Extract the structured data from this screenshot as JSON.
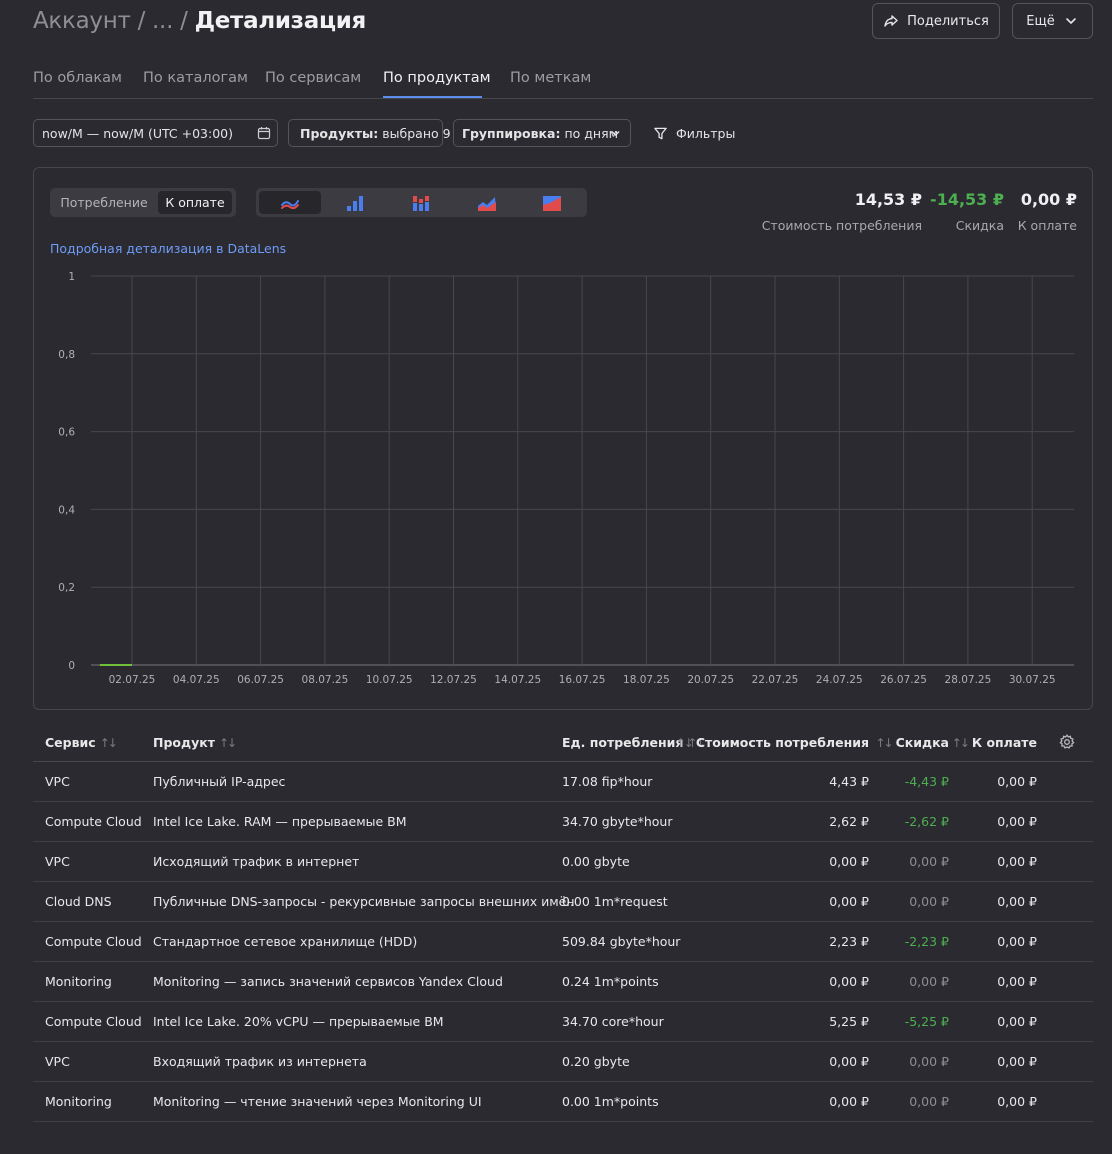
{
  "breadcrumb": {
    "root": "Аккаунт",
    "sep1": "/",
    "ellipsis": "...",
    "sep2": "/",
    "current": "Детализация"
  },
  "header": {
    "share_label": "Поделиться",
    "more_label": "Ещё"
  },
  "tabs": [
    {
      "label": "По облакам",
      "active": false
    },
    {
      "label": "По каталогам",
      "active": false
    },
    {
      "label": "По сервисам",
      "active": false
    },
    {
      "label": "По продуктам",
      "active": true
    },
    {
      "label": "По меткам",
      "active": false
    }
  ],
  "filters": {
    "date_range": "now/M — now/M (UTC +03:00)",
    "products_label": "Продукты:",
    "products_value": "выбрано 9",
    "grouping_label": "Группировка:",
    "grouping_value": "по дням",
    "filters_label": "Фильтры"
  },
  "chart_panel": {
    "mode_options": [
      "Потребление",
      "К оплате"
    ],
    "mode_selected": "К оплате",
    "chart_type_icons": [
      "line-chart-icon",
      "bar-chart-icon",
      "stacked-bar-chart-icon",
      "area-chart-icon",
      "stacked-area-chart-icon"
    ],
    "chart_type_selected": "line-chart-icon",
    "summary": [
      {
        "value": "14,53 ₽",
        "label": "Стоимость потребления",
        "color": "#f0f0f2"
      },
      {
        "value": "-14,53 ₽",
        "label": "Скидка",
        "color": "#4caf50"
      },
      {
        "value": "0,00 ₽",
        "label": "К оплате",
        "color": "#f0f0f2"
      }
    ],
    "datalens_link": "Подробная детализация в DataLens"
  },
  "chart_data": {
    "type": "line",
    "title": "",
    "xlabel": "",
    "ylabel": "",
    "ylim": [
      0,
      1
    ],
    "y_ticks": [
      "0",
      "0,2",
      "0,4",
      "0,6",
      "0,8",
      "1"
    ],
    "y_tick_values": [
      0,
      0.2,
      0.4,
      0.6,
      0.8,
      1
    ],
    "x_ticks": [
      "02.07.25",
      "04.07.25",
      "06.07.25",
      "08.07.25",
      "10.07.25",
      "12.07.25",
      "14.07.25",
      "16.07.25",
      "18.07.25",
      "20.07.25",
      "22.07.25",
      "24.07.25",
      "26.07.25",
      "28.07.25",
      "30.07.25"
    ],
    "x": [
      "01.07.25",
      "02.07.25"
    ],
    "series": [
      {
        "values": [
          0,
          0
        ],
        "color": "#6fbf3a"
      }
    ],
    "grid": true
  },
  "table": {
    "columns": [
      {
        "label": "Сервис",
        "sort": true
      },
      {
        "label": "Продукт",
        "sort": true
      },
      {
        "label": "Ед. потребления",
        "sort": true
      },
      {
        "label": "Стоимость потребления",
        "sort": true
      },
      {
        "label": "Скидка",
        "sort": true
      },
      {
        "label": "К оплате",
        "sort": true
      }
    ],
    "sort_glyph": "↑↓",
    "rows": [
      {
        "service": "VPC",
        "product": "Публичный IP-адрес",
        "unit": "17.08 fip*hour",
        "cost": "4,43 ₽",
        "discount": "-4,43 ₽",
        "discount_color": "green",
        "pay": "0,00 ₽"
      },
      {
        "service": "Compute Cloud",
        "product": "Intel Ice Lake. RAM — прерываемые ВМ",
        "unit": "34.70 gbyte*hour",
        "cost": "2,62 ₽",
        "discount": "-2,62 ₽",
        "discount_color": "green",
        "pay": "0,00 ₽"
      },
      {
        "service": "VPC",
        "product": "Исходящий трафик в интернет",
        "unit": "0.00 gbyte",
        "cost": "0,00 ₽",
        "discount": "0,00 ₽",
        "discount_color": "dim",
        "pay": "0,00 ₽"
      },
      {
        "service": "Cloud DNS",
        "product": "Публичные DNS-запросы - рекурсивные запросы внешних имён",
        "unit": "0.00 1m*request",
        "cost": "0,00 ₽",
        "discount": "0,00 ₽",
        "discount_color": "dim",
        "pay": "0,00 ₽"
      },
      {
        "service": "Compute Cloud",
        "product": "Стандартное сетевое хранилище (HDD)",
        "unit": "509.84 gbyte*hour",
        "cost": "2,23 ₽",
        "discount": "-2,23 ₽",
        "discount_color": "green",
        "pay": "0,00 ₽"
      },
      {
        "service": "Monitoring",
        "product": "Monitoring — запись значений сервисов Yandex Cloud",
        "unit": "0.24 1m*points",
        "cost": "0,00 ₽",
        "discount": "0,00 ₽",
        "discount_color": "dim",
        "pay": "0,00 ₽"
      },
      {
        "service": "Compute Cloud",
        "product": "Intel Ice Lake. 20% vCPU — прерываемые ВМ",
        "unit": "34.70 core*hour",
        "cost": "5,25 ₽",
        "discount": "-5,25 ₽",
        "discount_color": "green",
        "pay": "0,00 ₽"
      },
      {
        "service": "VPC",
        "product": "Входящий трафик из интернета",
        "unit": "0.20 gbyte",
        "cost": "0,00 ₽",
        "discount": "0,00 ₽",
        "discount_color": "dim",
        "pay": "0,00 ₽"
      },
      {
        "service": "Monitoring",
        "product": "Monitoring — чтение значений через Monitoring UI",
        "unit": "0.00 1m*points",
        "cost": "0,00 ₽",
        "discount": "0,00 ₽",
        "discount_color": "dim",
        "pay": "0,00 ₽"
      }
    ]
  }
}
